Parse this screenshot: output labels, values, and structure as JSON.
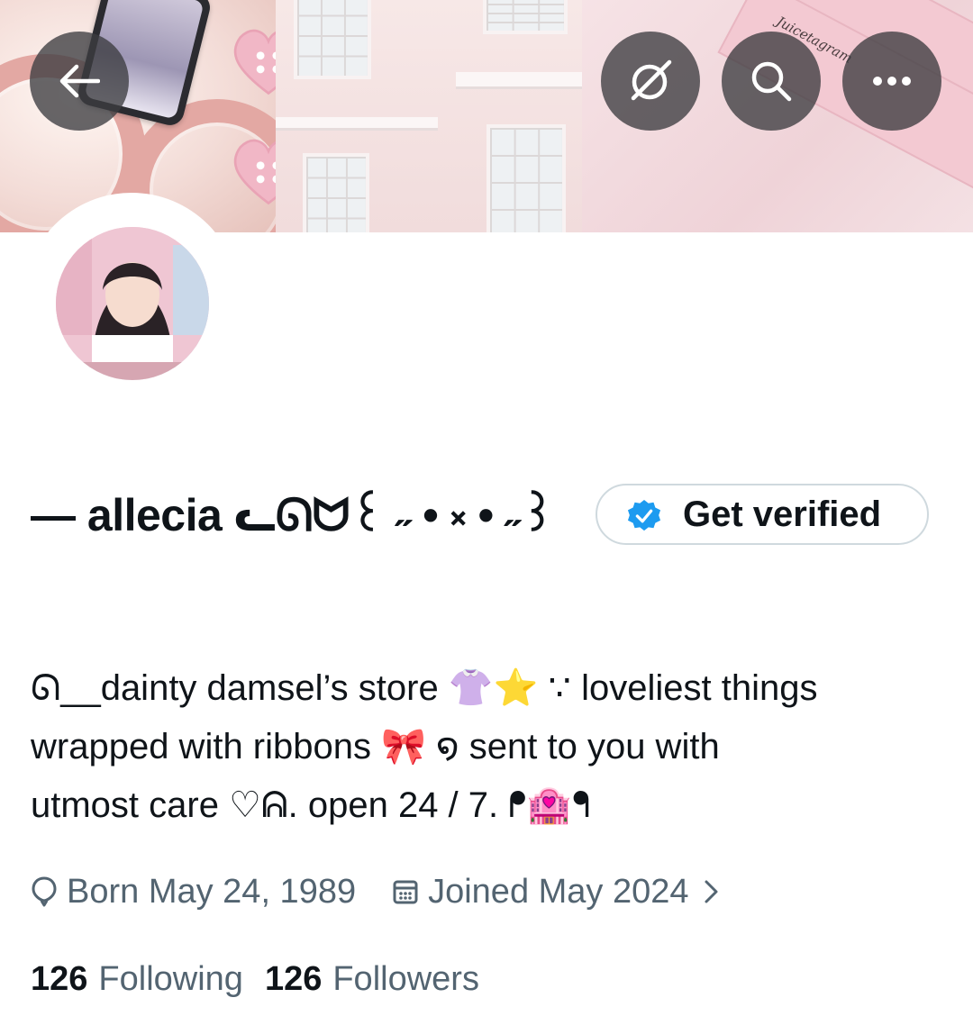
{
  "header": {
    "back_icon": "arrow-left-icon",
    "grok_icon": "grok-icon",
    "search_icon": "search-icon",
    "more_icon": "more-horizontal-icon"
  },
  "banner": {
    "book_text": "Juicetagram"
  },
  "profile": {
    "display_name": "— allecia ᓚᘏᗢ꒰ ˶ • ༝ • ˶꒱ ",
    "verify_button_label": "Get verified",
    "bio_lines": [
      "ᘏ__dainty damsel’s store 👚⭐ ∵ loveliest things",
      "wrapped with ribbons 🎀 ໑ sent to you with",
      "utmost care ♡ᕱ. open 24 / 7. ᖰ🏩ᖳ"
    ],
    "born_label": "Born May 24, 1989",
    "joined_label": "Joined May 2024",
    "following_count": "126",
    "following_label": "Following",
    "followers_count": "126",
    "followers_label": "Followers"
  },
  "colors": {
    "text_primary": "#0f1419",
    "text_secondary": "#536471",
    "border": "#cfd9de",
    "verified_blue": "#1d9bf0",
    "overlay_button": "#3c3c40"
  }
}
